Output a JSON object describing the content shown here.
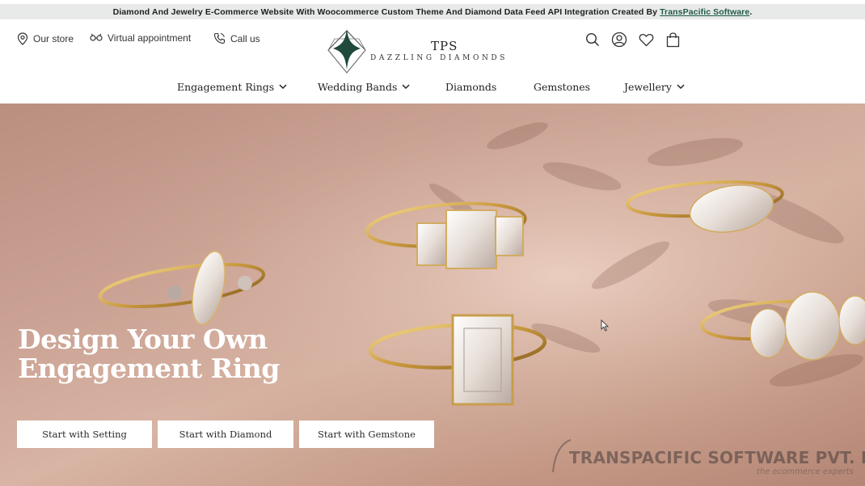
{
  "announcement": {
    "text": "Diamond And Jewelry E-Commerce Website With Woocommerce Custom Theme And Diamond Data Feed API Integration Created By",
    "link": "TransPacific Software",
    "suffix": "."
  },
  "utility": {
    "store": "Our store",
    "virtual": "Virtual appointment",
    "call": "Call us"
  },
  "logo": {
    "brand": "TPS",
    "tagline": "DAZZLING DIAMONDS"
  },
  "nav": {
    "items": [
      {
        "label": "Engagement Rings",
        "has_dropdown": true
      },
      {
        "label": "Wedding Bands",
        "has_dropdown": true
      },
      {
        "label": "Diamonds",
        "has_dropdown": false
      },
      {
        "label": "Gemstones",
        "has_dropdown": false
      },
      {
        "label": "Jewellery",
        "has_dropdown": true
      }
    ]
  },
  "header_icons": [
    "search-icon",
    "account-icon",
    "wishlist-heart-icon",
    "cart-bag-icon"
  ],
  "hero": {
    "title_line1": "Design Your Own",
    "title_line2": "Engagement Ring",
    "buttons": {
      "setting": "Start with Setting",
      "diamond": "Start with Diamond",
      "gemstone": "Start with Gemstone"
    }
  },
  "watermark": {
    "company": "TRANSPACIFIC SOFTWARE PVT. LTD.",
    "tagline": "the ecommerce experts"
  },
  "colors": {
    "brand_green": "#1f4a3c",
    "link_green": "#1f5a45",
    "announce_bg": "#e8eaea",
    "hero_tone": "#c9a092"
  }
}
